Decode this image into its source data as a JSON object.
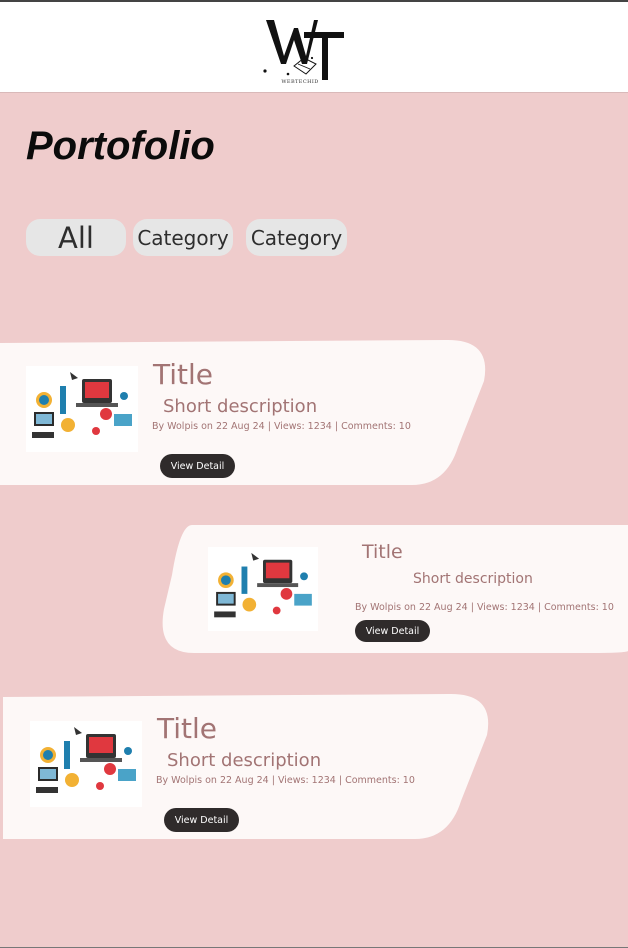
{
  "header": {
    "logo_text": "WEBTECHID"
  },
  "page": {
    "title": "Portofolio"
  },
  "filters": [
    {
      "label": "All"
    },
    {
      "label": "Category"
    },
    {
      "label": "Category"
    }
  ],
  "cards": [
    {
      "title": "Title",
      "description": "Short description",
      "meta": "By Wolpis on 22 Aug 24 | Views: 1234 | Comments: 10",
      "button": "View Detail"
    },
    {
      "title": "Title",
      "description": "Short description",
      "meta": "By Wolpis on 22 Aug 24 | Views: 1234 | Comments: 10",
      "button": "View Detail"
    },
    {
      "title": "Title",
      "description": "Short description",
      "meta": "By Wolpis on 22 Aug 24 | Views: 1234 | Comments: 10",
      "button": "View Detail"
    }
  ],
  "colors": {
    "background": "#efcccc",
    "card": "#fdf8f7",
    "text_accent": "#a27474",
    "button": "#2f2b2b"
  }
}
